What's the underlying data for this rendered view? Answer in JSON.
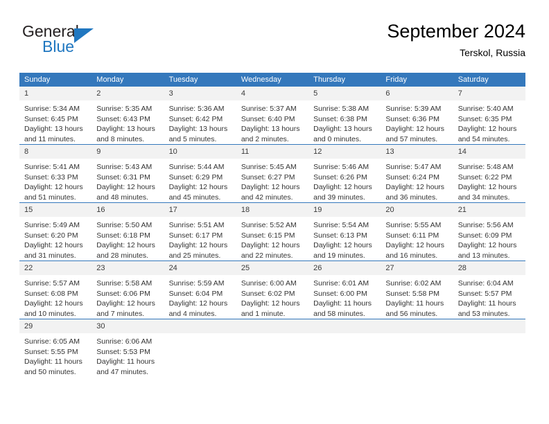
{
  "brand": {
    "name_top": "General",
    "name_bottom": "Blue",
    "accent_color": "#2077c0"
  },
  "header": {
    "title": "September 2024",
    "subtitle": "Terskol, Russia"
  },
  "theme": {
    "header_row_bg": "#3478bc",
    "daynum_bg": "#f2f2f2",
    "text_color": "#333333"
  },
  "weekday_headers": [
    "Sunday",
    "Monday",
    "Tuesday",
    "Wednesday",
    "Thursday",
    "Friday",
    "Saturday"
  ],
  "weeks": [
    {
      "days": [
        {
          "date": "1",
          "sunrise": "Sunrise: 5:34 AM",
          "sunset": "Sunset: 6:45 PM",
          "daylight": "Daylight: 13 hours and 11 minutes."
        },
        {
          "date": "2",
          "sunrise": "Sunrise: 5:35 AM",
          "sunset": "Sunset: 6:43 PM",
          "daylight": "Daylight: 13 hours and 8 minutes."
        },
        {
          "date": "3",
          "sunrise": "Sunrise: 5:36 AM",
          "sunset": "Sunset: 6:42 PM",
          "daylight": "Daylight: 13 hours and 5 minutes."
        },
        {
          "date": "4",
          "sunrise": "Sunrise: 5:37 AM",
          "sunset": "Sunset: 6:40 PM",
          "daylight": "Daylight: 13 hours and 2 minutes."
        },
        {
          "date": "5",
          "sunrise": "Sunrise: 5:38 AM",
          "sunset": "Sunset: 6:38 PM",
          "daylight": "Daylight: 13 hours and 0 minutes."
        },
        {
          "date": "6",
          "sunrise": "Sunrise: 5:39 AM",
          "sunset": "Sunset: 6:36 PM",
          "daylight": "Daylight: 12 hours and 57 minutes."
        },
        {
          "date": "7",
          "sunrise": "Sunrise: 5:40 AM",
          "sunset": "Sunset: 6:35 PM",
          "daylight": "Daylight: 12 hours and 54 minutes."
        }
      ]
    },
    {
      "days": [
        {
          "date": "8",
          "sunrise": "Sunrise: 5:41 AM",
          "sunset": "Sunset: 6:33 PM",
          "daylight": "Daylight: 12 hours and 51 minutes."
        },
        {
          "date": "9",
          "sunrise": "Sunrise: 5:43 AM",
          "sunset": "Sunset: 6:31 PM",
          "daylight": "Daylight: 12 hours and 48 minutes."
        },
        {
          "date": "10",
          "sunrise": "Sunrise: 5:44 AM",
          "sunset": "Sunset: 6:29 PM",
          "daylight": "Daylight: 12 hours and 45 minutes."
        },
        {
          "date": "11",
          "sunrise": "Sunrise: 5:45 AM",
          "sunset": "Sunset: 6:27 PM",
          "daylight": "Daylight: 12 hours and 42 minutes."
        },
        {
          "date": "12",
          "sunrise": "Sunrise: 5:46 AM",
          "sunset": "Sunset: 6:26 PM",
          "daylight": "Daylight: 12 hours and 39 minutes."
        },
        {
          "date": "13",
          "sunrise": "Sunrise: 5:47 AM",
          "sunset": "Sunset: 6:24 PM",
          "daylight": "Daylight: 12 hours and 36 minutes."
        },
        {
          "date": "14",
          "sunrise": "Sunrise: 5:48 AM",
          "sunset": "Sunset: 6:22 PM",
          "daylight": "Daylight: 12 hours and 34 minutes."
        }
      ]
    },
    {
      "days": [
        {
          "date": "15",
          "sunrise": "Sunrise: 5:49 AM",
          "sunset": "Sunset: 6:20 PM",
          "daylight": "Daylight: 12 hours and 31 minutes."
        },
        {
          "date": "16",
          "sunrise": "Sunrise: 5:50 AM",
          "sunset": "Sunset: 6:18 PM",
          "daylight": "Daylight: 12 hours and 28 minutes."
        },
        {
          "date": "17",
          "sunrise": "Sunrise: 5:51 AM",
          "sunset": "Sunset: 6:17 PM",
          "daylight": "Daylight: 12 hours and 25 minutes."
        },
        {
          "date": "18",
          "sunrise": "Sunrise: 5:52 AM",
          "sunset": "Sunset: 6:15 PM",
          "daylight": "Daylight: 12 hours and 22 minutes."
        },
        {
          "date": "19",
          "sunrise": "Sunrise: 5:54 AM",
          "sunset": "Sunset: 6:13 PM",
          "daylight": "Daylight: 12 hours and 19 minutes."
        },
        {
          "date": "20",
          "sunrise": "Sunrise: 5:55 AM",
          "sunset": "Sunset: 6:11 PM",
          "daylight": "Daylight: 12 hours and 16 minutes."
        },
        {
          "date": "21",
          "sunrise": "Sunrise: 5:56 AM",
          "sunset": "Sunset: 6:09 PM",
          "daylight": "Daylight: 12 hours and 13 minutes."
        }
      ]
    },
    {
      "days": [
        {
          "date": "22",
          "sunrise": "Sunrise: 5:57 AM",
          "sunset": "Sunset: 6:08 PM",
          "daylight": "Daylight: 12 hours and 10 minutes."
        },
        {
          "date": "23",
          "sunrise": "Sunrise: 5:58 AM",
          "sunset": "Sunset: 6:06 PM",
          "daylight": "Daylight: 12 hours and 7 minutes."
        },
        {
          "date": "24",
          "sunrise": "Sunrise: 5:59 AM",
          "sunset": "Sunset: 6:04 PM",
          "daylight": "Daylight: 12 hours and 4 minutes."
        },
        {
          "date": "25",
          "sunrise": "Sunrise: 6:00 AM",
          "sunset": "Sunset: 6:02 PM",
          "daylight": "Daylight: 12 hours and 1 minute."
        },
        {
          "date": "26",
          "sunrise": "Sunrise: 6:01 AM",
          "sunset": "Sunset: 6:00 PM",
          "daylight": "Daylight: 11 hours and 58 minutes."
        },
        {
          "date": "27",
          "sunrise": "Sunrise: 6:02 AM",
          "sunset": "Sunset: 5:58 PM",
          "daylight": "Daylight: 11 hours and 56 minutes."
        },
        {
          "date": "28",
          "sunrise": "Sunrise: 6:04 AM",
          "sunset": "Sunset: 5:57 PM",
          "daylight": "Daylight: 11 hours and 53 minutes."
        }
      ]
    },
    {
      "days": [
        {
          "date": "29",
          "sunrise": "Sunrise: 6:05 AM",
          "sunset": "Sunset: 5:55 PM",
          "daylight": "Daylight: 11 hours and 50 minutes."
        },
        {
          "date": "30",
          "sunrise": "Sunrise: 6:06 AM",
          "sunset": "Sunset: 5:53 PM",
          "daylight": "Daylight: 11 hours and 47 minutes."
        },
        {
          "date": "",
          "sunrise": "",
          "sunset": "",
          "daylight": ""
        },
        {
          "date": "",
          "sunrise": "",
          "sunset": "",
          "daylight": ""
        },
        {
          "date": "",
          "sunrise": "",
          "sunset": "",
          "daylight": ""
        },
        {
          "date": "",
          "sunrise": "",
          "sunset": "",
          "daylight": ""
        },
        {
          "date": "",
          "sunrise": "",
          "sunset": "",
          "daylight": ""
        }
      ]
    }
  ]
}
